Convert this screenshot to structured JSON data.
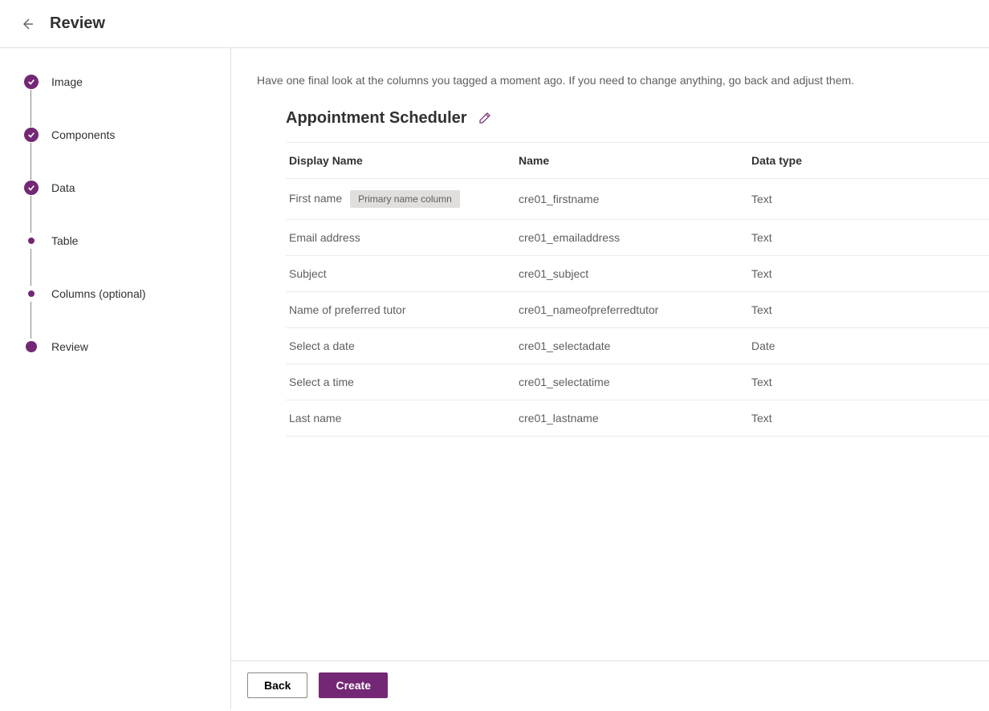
{
  "header": {
    "title": "Review"
  },
  "sidebar": {
    "steps": [
      {
        "label": "Image",
        "state": "check"
      },
      {
        "label": "Components",
        "state": "check"
      },
      {
        "label": "Data",
        "state": "check"
      },
      {
        "label": "Table",
        "state": "dot-small"
      },
      {
        "label": "Columns (optional)",
        "state": "dot-small"
      },
      {
        "label": "Review",
        "state": "dot-large"
      }
    ]
  },
  "content": {
    "intro": "Have one final look at the columns you tagged a moment ago. If you need to change anything, go back and adjust them.",
    "section_title": "Appointment Scheduler",
    "columns": {
      "display_name": "Display Name",
      "name": "Name",
      "data_type": "Data type"
    },
    "primary_badge": "Primary name column",
    "rows": [
      {
        "display": "First name",
        "name": "cre01_firstname",
        "type": "Text",
        "primary": true
      },
      {
        "display": "Email address",
        "name": "cre01_emailaddress",
        "type": "Text",
        "primary": false
      },
      {
        "display": "Subject",
        "name": "cre01_subject",
        "type": "Text",
        "primary": false
      },
      {
        "display": "Name of preferred tutor",
        "name": "cre01_nameofpreferredtutor",
        "type": "Text",
        "primary": false
      },
      {
        "display": "Select a date",
        "name": "cre01_selectadate",
        "type": "Date",
        "primary": false
      },
      {
        "display": "Select a time",
        "name": "cre01_selectatime",
        "type": "Text",
        "primary": false
      },
      {
        "display": "Last name",
        "name": "cre01_lastname",
        "type": "Text",
        "primary": false
      }
    ]
  },
  "footer": {
    "back": "Back",
    "create": "Create"
  }
}
